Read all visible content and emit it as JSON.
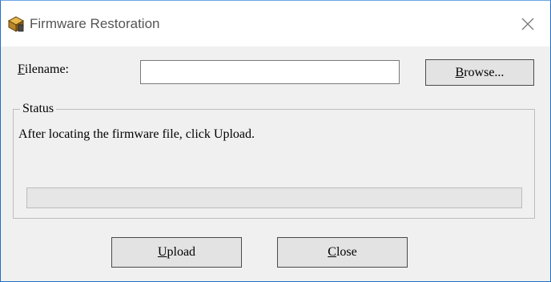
{
  "window": {
    "title": "Firmware Restoration",
    "app_icon": "cube-app-icon",
    "close_icon": "close-icon"
  },
  "filename": {
    "label_underline": "F",
    "label_rest": "ilename:",
    "value": "",
    "placeholder": ""
  },
  "browse_button": {
    "underline": "B",
    "rest": "rowse..."
  },
  "status": {
    "legend": "Status",
    "message": "After locating the firmware file, click Upload.",
    "progress_fraction": 0
  },
  "upload_button": {
    "underline": "U",
    "rest": "pload"
  },
  "close_button": {
    "underline": "C",
    "rest": "lose"
  }
}
